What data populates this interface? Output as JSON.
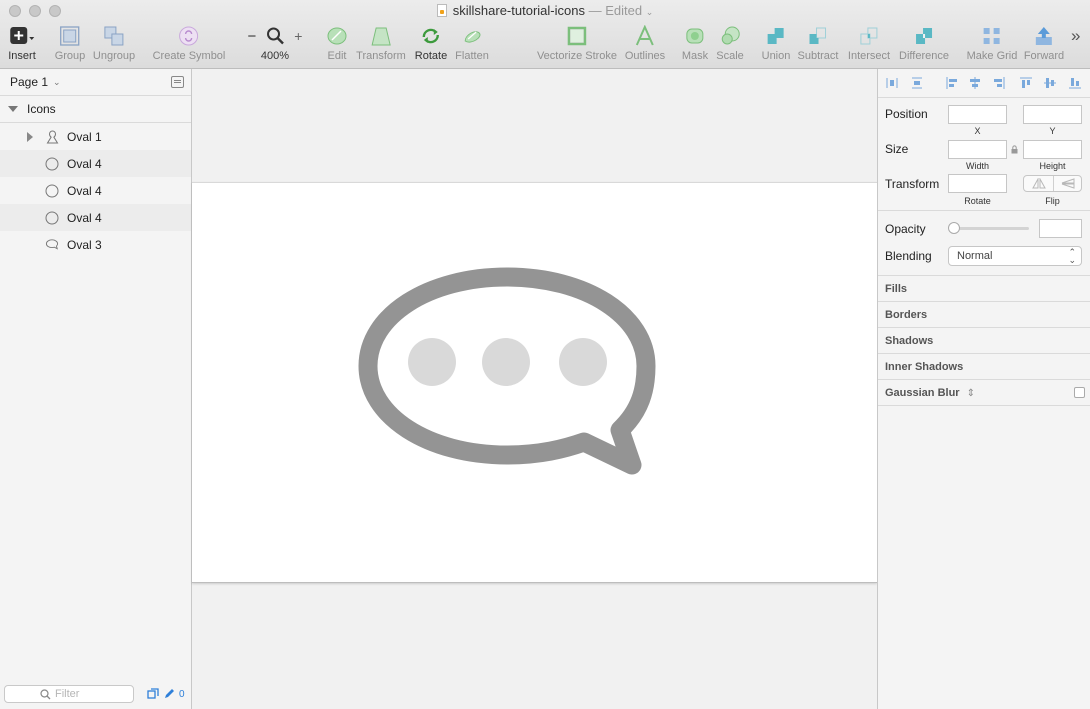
{
  "window": {
    "title": "skillshare-tutorial-icons",
    "status": "— Edited"
  },
  "toolbar": {
    "insert": "Insert",
    "group": "Group",
    "ungroup": "Ungroup",
    "create_symbol": "Create Symbol",
    "zoom_minus": "−",
    "zoom_plus": "+",
    "zoom_level": "400%",
    "edit": "Edit",
    "transform": "Transform",
    "rotate": "Rotate",
    "flatten": "Flatten",
    "vectorize_stroke": "Vectorize Stroke",
    "outlines": "Outlines",
    "mask": "Mask",
    "scale": "Scale",
    "union": "Union",
    "subtract": "Subtract",
    "intersect": "Intersect",
    "difference": "Difference",
    "make_grid": "Make Grid",
    "forward": "Forward",
    "more": "»"
  },
  "sidebar": {
    "page": "Page 1",
    "group_name": "Icons",
    "layers": [
      {
        "name": "Oval 1",
        "icon": "person-mask-icon"
      },
      {
        "name": "Oval 4",
        "icon": "oval-icon"
      },
      {
        "name": "Oval 4",
        "icon": "oval-icon"
      },
      {
        "name": "Oval 4",
        "icon": "oval-icon"
      },
      {
        "name": "Oval 3",
        "icon": "speech-bubble-icon"
      }
    ],
    "filter_placeholder": "Filter",
    "footer_count": "0"
  },
  "inspector": {
    "position": "Position",
    "x": "X",
    "y": "Y",
    "size": "Size",
    "width": "Width",
    "height": "Height",
    "transform": "Transform",
    "rotate": "Rotate",
    "flip": "Flip",
    "opacity": "Opacity",
    "blending": "Blending",
    "blending_value": "Normal",
    "sections": {
      "fills": "Fills",
      "borders": "Borders",
      "shadows": "Shadows",
      "inner_shadows": "Inner Shadows",
      "gaussian_blur": "Gaussian Blur"
    }
  },
  "colors": {
    "accent": "#2f80d9",
    "bubble_stroke": "#949494",
    "dot_fill": "#d9d9d9",
    "op_icon_teal": "#5ab8c4",
    "op_icon_green": "#5cb85c"
  }
}
